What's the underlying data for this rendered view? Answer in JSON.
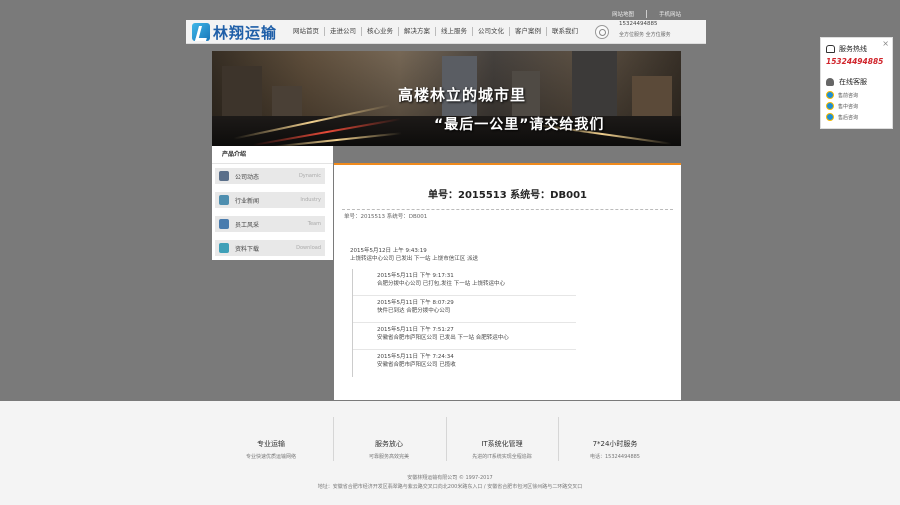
{
  "header": {
    "logo_text": "林翔运输",
    "nav": [
      "网站首页",
      "走进公司",
      "核心业务",
      "解决方案",
      "线上服务",
      "公司文化",
      "客户案例",
      "联系我们"
    ],
    "top_links": [
      "网站地图",
      "手机网站"
    ],
    "phone": "15324494885",
    "sub_text": "全方位服务  全方位服务"
  },
  "banner": {
    "line1": "高楼林立的城市里",
    "line2": "“最后一公里”请交给我们"
  },
  "sidebar": {
    "title": "产品介绍",
    "items": [
      {
        "label": "公司动态",
        "en": "Dynamic",
        "icon": "news-icon",
        "color": "#5a6f8a"
      },
      {
        "label": "行业新闻",
        "en": "Industry",
        "icon": "book-icon",
        "color": "#4f8fb0"
      },
      {
        "label": "员工风采",
        "en": "Team",
        "icon": "building-icon",
        "color": "#4a7cae"
      },
      {
        "label": "资料下载",
        "en": "Download",
        "icon": "feather-icon",
        "color": "#3fa0b8"
      }
    ]
  },
  "order": {
    "title": "单号：2015513 系统号：DB001",
    "meta": "单号：2015513  系统号：DB001",
    "first": {
      "time": "2015年5月12日 上午 9:43:19",
      "desc": "上饶转运中心公司 已发出 下一站 上饶市信江区 派送"
    },
    "tracks": [
      {
        "time": "2015年5月11日 下午 9:17:31",
        "desc": "合肥分拨中心公司 已打包,发往 下一站 上饶转运中心"
      },
      {
        "time": "2015年5月11日 下午 8:07:29",
        "desc": "快件已到达 合肥分拨中心公司"
      },
      {
        "time": "2015年5月11日 下午 7:51:27",
        "desc": "安徽省合肥市庐阳区公司 已发出 下一站 合肥转运中心"
      },
      {
        "time": "2015年5月11日 下午 7:24:34",
        "desc": "安徽省合肥市庐阳区公司 已揽收"
      }
    ]
  },
  "service": {
    "close": "×",
    "hotline_label": "服务热线",
    "phone": "15324494885",
    "online_label": "在线客服",
    "agents": [
      "售前咨询",
      "售中咨询",
      "售后咨询"
    ]
  },
  "footer": {
    "features": [
      {
        "title": "专业运输",
        "desc": "专业快速优质运输网络"
      },
      {
        "title": "服务放心",
        "desc": "可靠服务高效完美"
      },
      {
        "title": "IT系统化管理",
        "desc": "先进的IT系统实现全程追踪"
      },
      {
        "title": "7*24小时服务",
        "desc": "电话：15324494885"
      }
    ],
    "copyright": "安徽林翔运输有限公司 © 1997-2017",
    "address": "地址：安徽省合肥市经济开发区翡翠路与紫云路交叉口向北200米路东入口 / 安徽省合肥市包河区徐州路与二环路交叉口"
  }
}
